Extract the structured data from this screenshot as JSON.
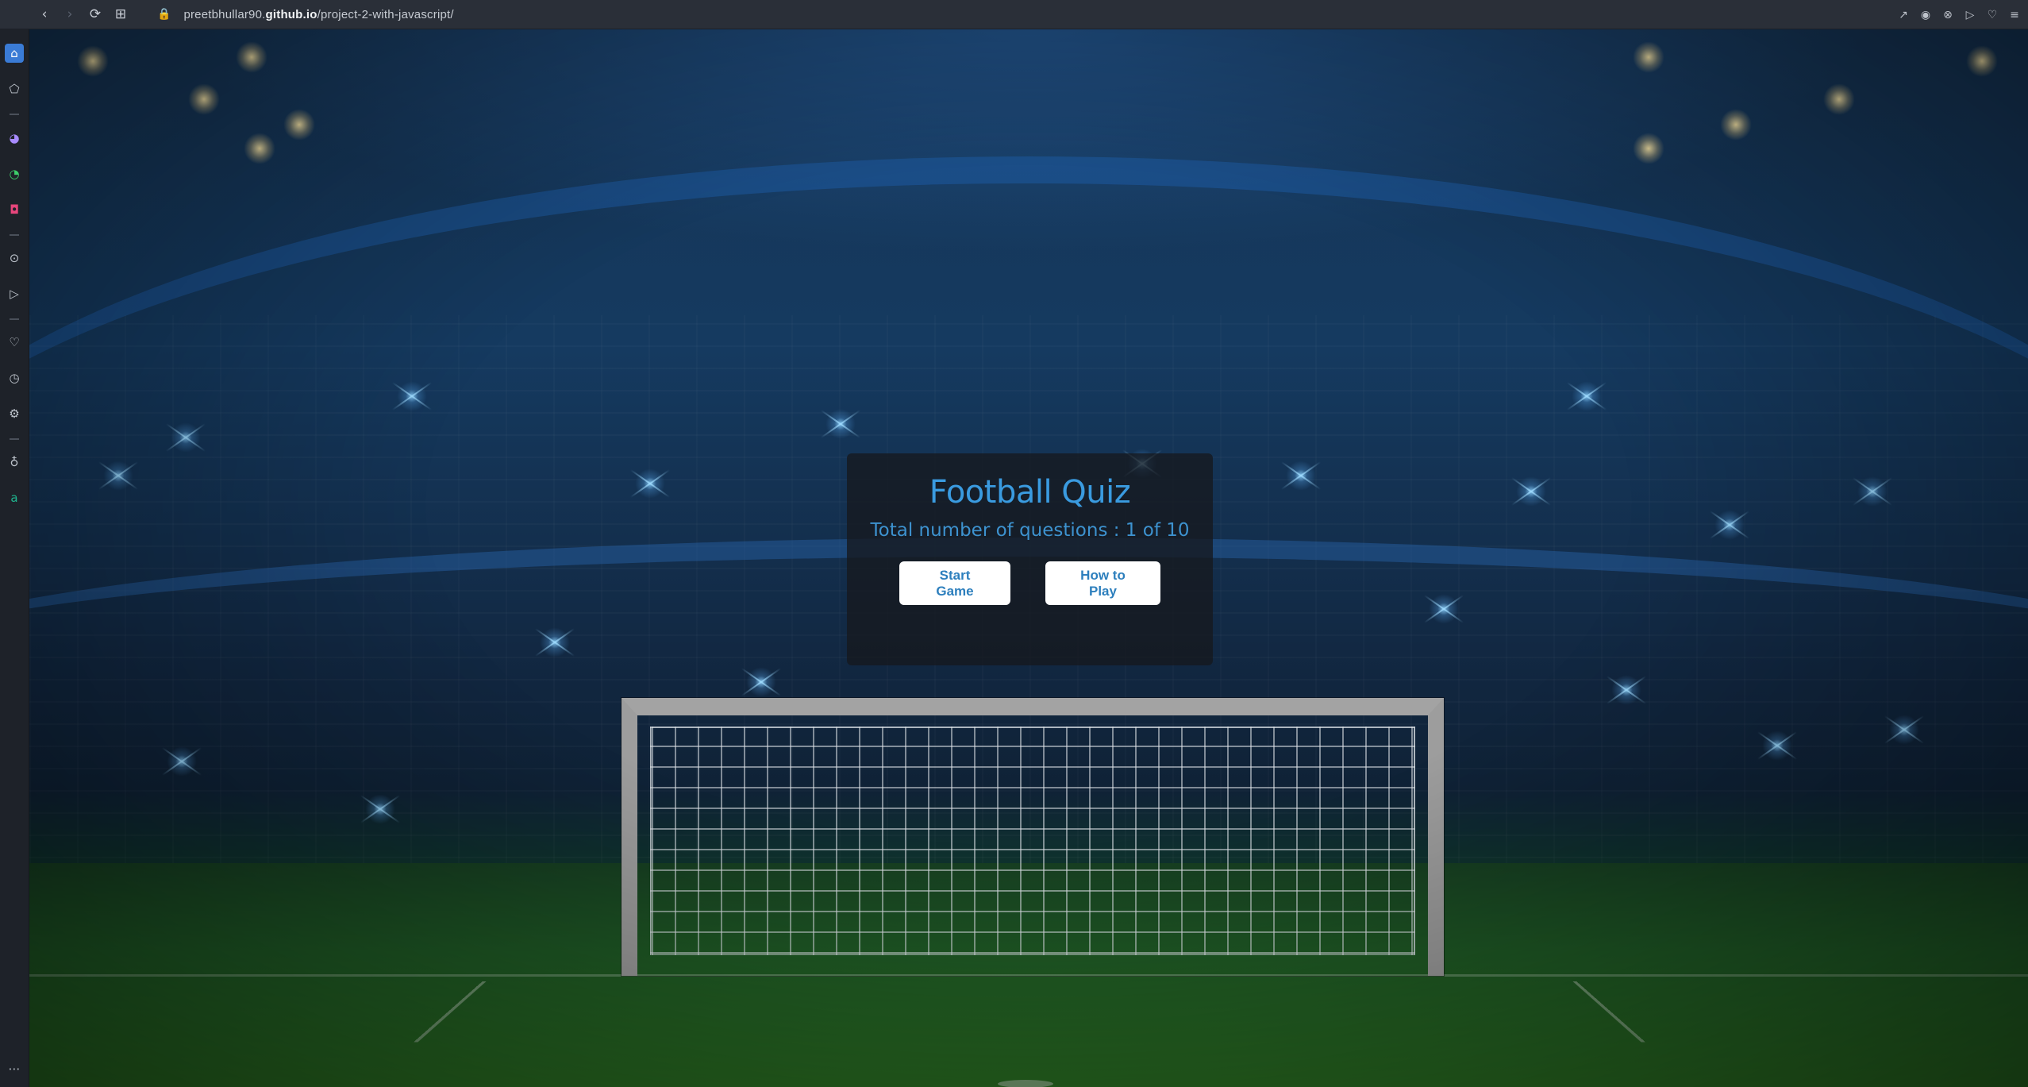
{
  "browser": {
    "url_prefix": "preetbhullar90.",
    "url_domain": "github.io",
    "url_path": "/project-2-with-javascript/",
    "nav": {
      "back_icon": "‹",
      "forward_icon": "›",
      "reload_icon": "⟳",
      "tabs_icon": "⊞"
    },
    "lock_icon": "🔒",
    "right_icons": [
      "↗",
      "◉",
      "⊗",
      "▷",
      "♡",
      "≡"
    ]
  },
  "sidebar": {
    "items": [
      {
        "name": "home-icon",
        "glyph": "⌂"
      },
      {
        "name": "bookmark-icon",
        "glyph": "⬠"
      },
      {
        "name": "messenger-icon",
        "glyph": "◕"
      },
      {
        "name": "whatsapp-icon",
        "glyph": "◔"
      },
      {
        "name": "instagram-icon",
        "glyph": "◘"
      },
      {
        "name": "player-icon",
        "glyph": "⊙"
      },
      {
        "name": "send-icon",
        "glyph": "▷"
      },
      {
        "name": "heart-icon",
        "glyph": "♡"
      },
      {
        "name": "history-icon",
        "glyph": "◷"
      },
      {
        "name": "settings-icon",
        "glyph": "⚙"
      },
      {
        "name": "tips-icon",
        "glyph": "♁"
      },
      {
        "name": "extension-icon",
        "glyph": "a"
      },
      {
        "name": "more-icon",
        "glyph": "⋯"
      }
    ]
  },
  "quiz": {
    "title": "Football Quiz",
    "subtitle": "Total number of questions : 1 of 10",
    "start_label": "Start Game",
    "how_label": "How to Play"
  },
  "colors": {
    "title": "#3a9be0",
    "button_text": "#2d7fbd",
    "card_bg": "rgba(22,24,30,0.78)"
  }
}
